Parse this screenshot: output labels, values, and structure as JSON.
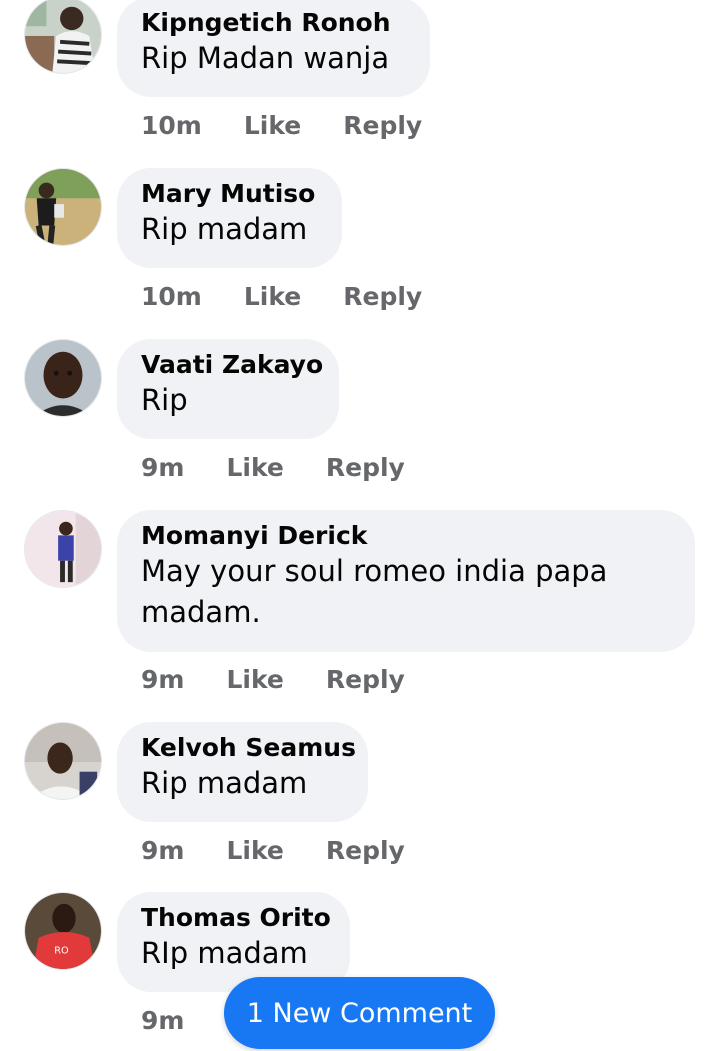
{
  "actions": {
    "like_label": "Like",
    "reply_label": "Reply"
  },
  "comments": [
    {
      "author": "Kipngetich Ronoh",
      "text": "Rip Madan wanja",
      "time": "10m"
    },
    {
      "author": "Mary Mutiso",
      "text": "Rip madam",
      "time": "10m"
    },
    {
      "author": "Vaati Zakayo",
      "text": "Rip",
      "time": "9m"
    },
    {
      "author": "Momanyi Derick",
      "text": "May your soul romeo india papa madam.",
      "time": "9m"
    },
    {
      "author": "Kelvoh Seamus",
      "text": "Rip madam",
      "time": "9m"
    },
    {
      "author": "Thomas Orito",
      "text": "RIp madam",
      "time": "9m"
    }
  ],
  "new_comment_pill": {
    "label": "1 New Comment"
  },
  "colors": {
    "bubble": "#f0f2f5",
    "meta_text": "#65676b",
    "accent": "#1877f2"
  }
}
